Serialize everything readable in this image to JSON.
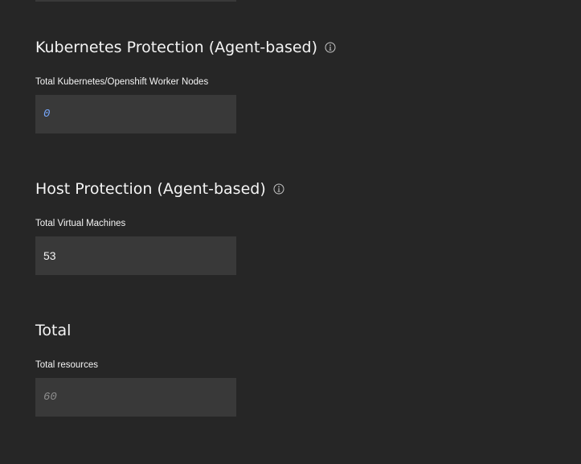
{
  "sections": [
    {
      "heading": "Kubernetes Protection (Agent-based)",
      "has_info": true,
      "field_label": "Total Kubernetes/Openshift Worker Nodes",
      "field_value": "0"
    },
    {
      "heading": "Host Protection (Agent-based)",
      "has_info": true,
      "field_label": "Total Virtual Machines",
      "field_value": "53"
    },
    {
      "heading": "Total",
      "has_info": false,
      "field_label": "Total resources",
      "field_value": "60"
    }
  ],
  "colors": {
    "background": "#262626",
    "field_background": "#393939",
    "text": "#f4f4f4",
    "link_value": "#78a9ff",
    "muted_value": "#8d8d8d"
  }
}
